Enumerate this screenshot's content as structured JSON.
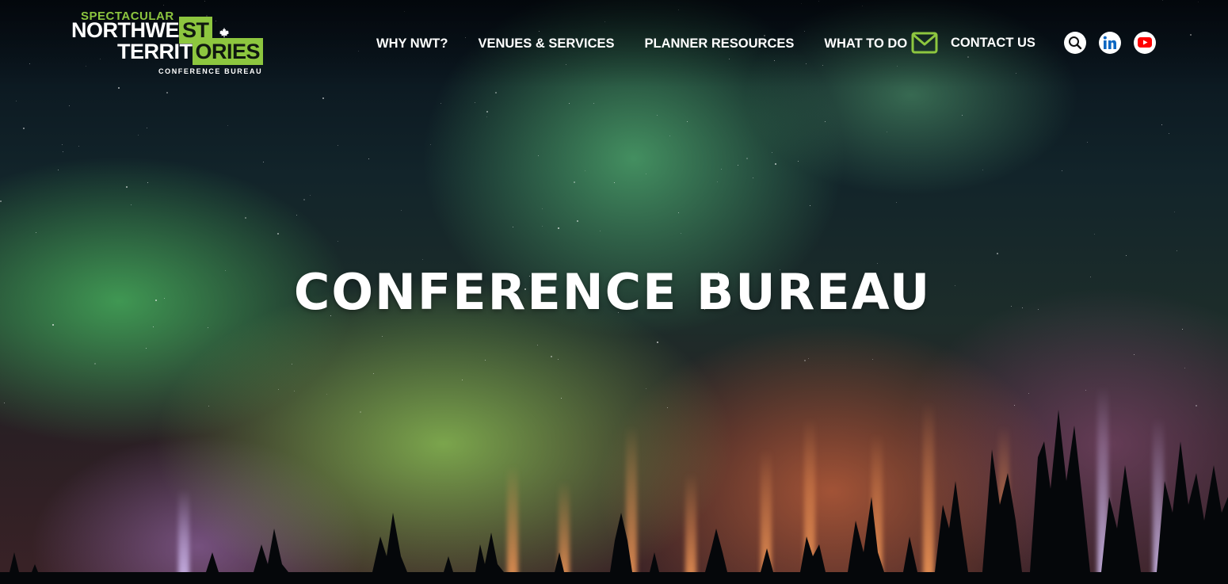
{
  "logo": {
    "top": "SPECTACULAR",
    "line1_a": "NORTHWE",
    "line1_b": "ST",
    "line2_a": "TERRIT",
    "line2_b": "ORIES",
    "sub": "CONFERENCE BUREAU",
    "icon": "maple-leaf-icon"
  },
  "nav": {
    "items": [
      {
        "label": "WHY NWT?"
      },
      {
        "label": "VENUES & SERVICES"
      },
      {
        "label": "PLANNER RESOURCES"
      },
      {
        "label": "WHAT TO DO"
      }
    ],
    "contact_label": "CONTACT US",
    "contact_icon": "envelope-icon"
  },
  "header_icons": [
    {
      "name": "search-icon"
    },
    {
      "name": "linkedin-icon"
    },
    {
      "name": "youtube-icon"
    }
  ],
  "hero": {
    "title": "CONFERENCE BUREAU"
  },
  "colors": {
    "brand_green": "#8dc63f",
    "text": "#ffffff",
    "linkedin": "#0a66c2",
    "youtube": "#ff0000"
  }
}
